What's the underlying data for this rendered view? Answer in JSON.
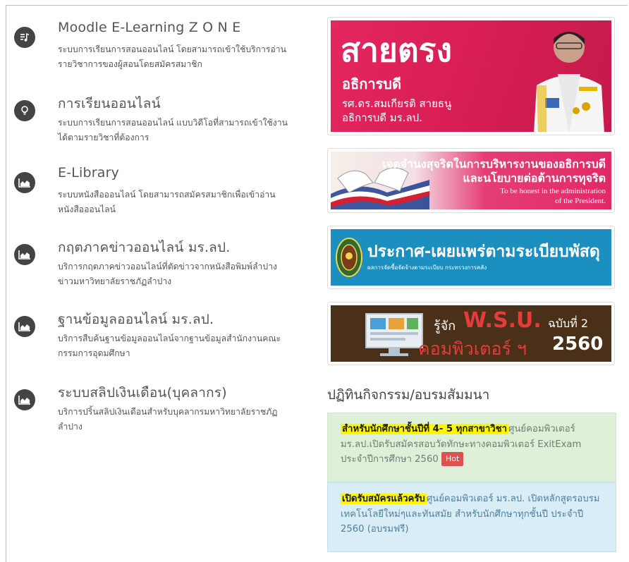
{
  "services": [
    {
      "icon": "music-note-icon",
      "title": "Moodle E-Learning Z O N E",
      "desc": "ระบบการเรียนการสอนออนไลน์ โดยสามารถเข้าใช้บริการอ่านรายวิชาการของผู้สอนโดยสมัครสมาชิก"
    },
    {
      "icon": "lightbulb-icon",
      "title": "การเรียนออนไลน์",
      "desc": "ระบบการเรียนการสอนออนไลน์ แบบวิดีโอที่สามารถเข้าใช้งานได้ตามรายวิชาที่ต้องการ"
    },
    {
      "icon": "area-chart-icon",
      "title": "E-Library",
      "desc": "ระบบหนังสือออนไลน์ โดยสามารถสมัครสมาชิกเพื่อเข้าอ่านหนังสือออนไลน์"
    },
    {
      "icon": "area-chart-icon",
      "title": "กฤตภาคข่าวออนไลน์ มร.ลป.",
      "desc": "บริการกฤตภาคข่าวออนไลน์ที่ตัดข่าวจากหนังสือพิมพ์ลำปาง ข่าวมหาวิทยาลัยราชภัฏลำปาง"
    },
    {
      "icon": "area-chart-icon",
      "title": "ฐานข้อมูลออนไลน์ มร.ลป.",
      "desc": "บริการสืบค้นฐานข้อมูลออนไลน์จากฐานข้อมูลสำนักงานคณะกรรมการอุดมศึกษา"
    },
    {
      "icon": "area-chart-icon",
      "title": "ระบบสลิปเงินเดือน(บุคลากร)",
      "desc": "บริการปริ้นสลิปเงินเดือนสำหรับบุคลากรมหาวิทยาลัยราชภัฏลำปาง"
    }
  ],
  "banners": {
    "b1": {
      "headline": "สายตรง",
      "sub": "อธิการบดี",
      "name": "รศ.ดร.สมเกียรติ สายธนู",
      "position": "อธิการบดี มร.ลป."
    },
    "b2": {
      "line1": "เจตจำนงสุจริตในการบริหารงานของอธิการบดี",
      "line2": "และนโยบายต่อต้านการทุจริต",
      "en1": "To be honest in the administration",
      "en2": "of the President."
    },
    "b3": {
      "title": "ประกาศ-เผยแพร่ตามระเบียบพัสดุ",
      "sub": "ผลการจัดซื้อจัดจ้างตามระเบียบ กระทรวงการคลัง"
    },
    "b4": {
      "prefix": "รู้จัก",
      "brand": "W.S.U.",
      "issue": "ฉบับที่ 2",
      "line2": "คอมพิวเตอร์ ฯ",
      "year": "2560"
    }
  },
  "activities": {
    "title": "ปฏิทินกิจกรรม/อบรมสัมมนา",
    "items": [
      {
        "highlight": "สำหรับนักศึกษาชั้นปีที่ 4- 5 ทุกสาขาวิชา",
        "text": "ศูนย์คอมพิวเตอร์ มร.ลป.เปิดรับสมัครสอบวัดทักษะทางคอมพิวเตอร์ ExitExam ประจำปีการศึกษา 2560",
        "badge": "Hot"
      },
      {
        "highlight": "เปิดรับสมัครแล้วครับ",
        "text": "ศูนย์คอมพิวเตอร์ มร.ลป. เปิดหลักสูตรอบรมเทคโนโลยีใหม่ๆและทันสมัย สำหรับนักศึกษาทุกชั้นปี ประจำปี 2560 (อบรมฟรี)",
        "badge": ""
      }
    ]
  }
}
